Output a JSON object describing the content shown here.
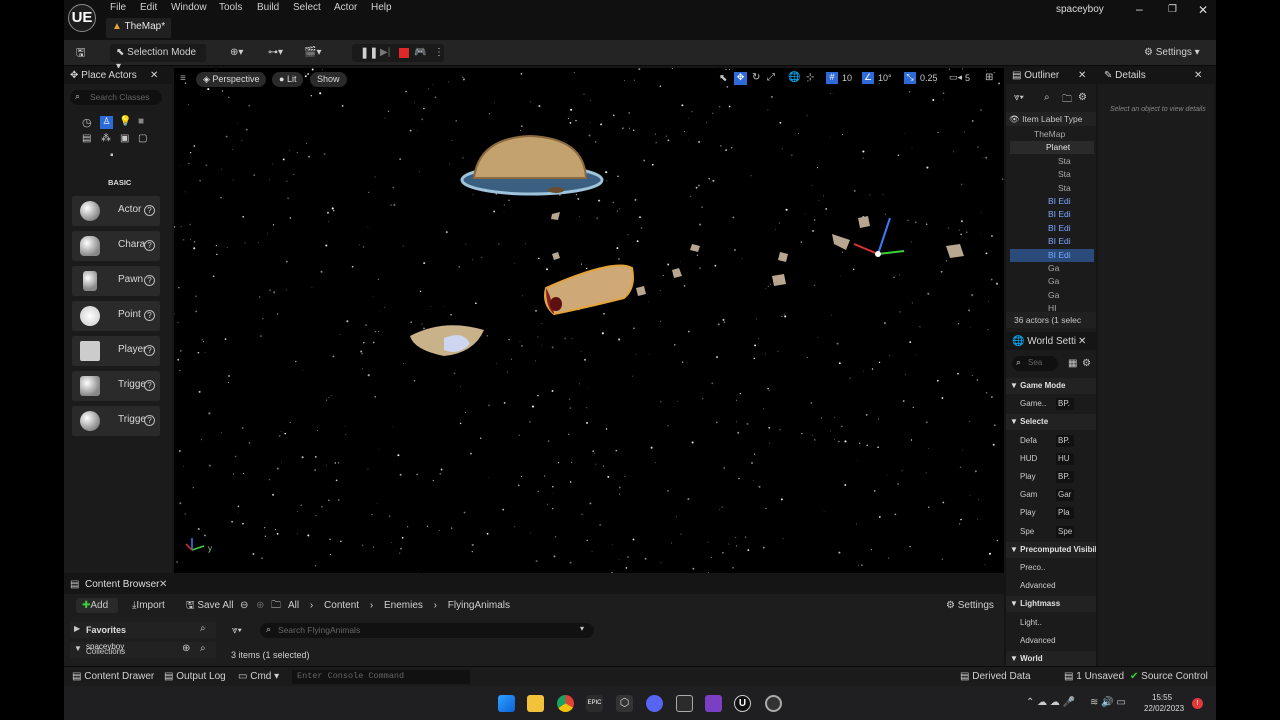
{
  "app": {
    "tab_title": "TheMap*",
    "user": "spaceyboy",
    "logo": "UE"
  },
  "menu": [
    "File",
    "Edit",
    "Window",
    "Tools",
    "Build",
    "Select",
    "Actor",
    "Help"
  ],
  "toolbar": {
    "selection_mode": "Selection Mode",
    "settings": "Settings"
  },
  "place_actors": {
    "title": "Place Actors",
    "search_placeholder": "Search Classes",
    "category": "BASIC",
    "items": [
      "Actor",
      "Chara",
      "Pawn",
      "Point",
      "Player",
      "Trigge",
      "Trigge"
    ]
  },
  "viewport": {
    "perspective": "Perspective",
    "lit": "Lit",
    "show": "Show",
    "grid": "10",
    "angle": "10°",
    "scale": "0.25",
    "camera_speed": "5",
    "axis_label": "y"
  },
  "outliner": {
    "title": "Outliner",
    "column": "Item Label Type",
    "rows": [
      "TheMap",
      "Planet",
      "Sta",
      "Sta",
      "Sta",
      "BI Edi",
      "BI Edi",
      "BI Edi",
      "BI Edi",
      "BI Edi",
      "Ga",
      "Ga",
      "Ga",
      "HI"
    ],
    "count": "36 actors (1 selec"
  },
  "world_settings": {
    "title": "World Setti",
    "search_placeholder": "Sea",
    "rows": [
      {
        "label": "Game Mode",
        "value": "",
        "header": true
      },
      {
        "label": "Game..",
        "value": "BP.",
        "header": false
      },
      {
        "label": "Selecte",
        "value": "",
        "header": true
      },
      {
        "label": "Defa",
        "value": "BP.",
        "header": false
      },
      {
        "label": "HUD",
        "value": "HU",
        "header": false
      },
      {
        "label": "Play",
        "value": "BP.",
        "header": false
      },
      {
        "label": "Gam",
        "value": "Gar",
        "header": false
      },
      {
        "label": "Play",
        "value": "Pla",
        "header": false
      },
      {
        "label": "Spe",
        "value": "Spe",
        "header": false
      },
      {
        "label": "Precomputed Visibil",
        "value": "",
        "header": true
      },
      {
        "label": "Preco..",
        "value": "",
        "header": false
      },
      {
        "label": "Advanced",
        "value": "",
        "header": false
      },
      {
        "label": "Lightmass",
        "value": "",
        "header": true
      },
      {
        "label": "Light..",
        "value": "",
        "header": false
      },
      {
        "label": "Advanced",
        "value": "",
        "header": false
      },
      {
        "label": "World",
        "value": "",
        "header": true
      }
    ]
  },
  "details": {
    "title": "Details",
    "empty": "Select an object to view details"
  },
  "content_browser": {
    "title": "Content Browser",
    "add": "Add",
    "import": "Import",
    "save_all": "Save All",
    "breadcrumb": [
      "All",
      "Content",
      "Enemies",
      "FlyingAnimals"
    ],
    "settings": "Settings",
    "favorites": "Favorites",
    "project": "spaceyboy",
    "collections": "Collections",
    "search_placeholder": "Search FlyingAnimals",
    "items_count": "3 items (1 selected)"
  },
  "statusbar": {
    "content_drawer": "Content Drawer",
    "output_log": "Output Log",
    "cmd": "Cmd",
    "console_placeholder": "Enter Console Command",
    "derived_data": "Derived Data",
    "unsaved": "1 Unsaved",
    "source_control": "Source Control"
  },
  "taskbar": {
    "time": "15:55",
    "date": "22/02/2023"
  },
  "colors": {
    "selection": "#2e6ad8",
    "accent_orange": "#e2a33a"
  }
}
